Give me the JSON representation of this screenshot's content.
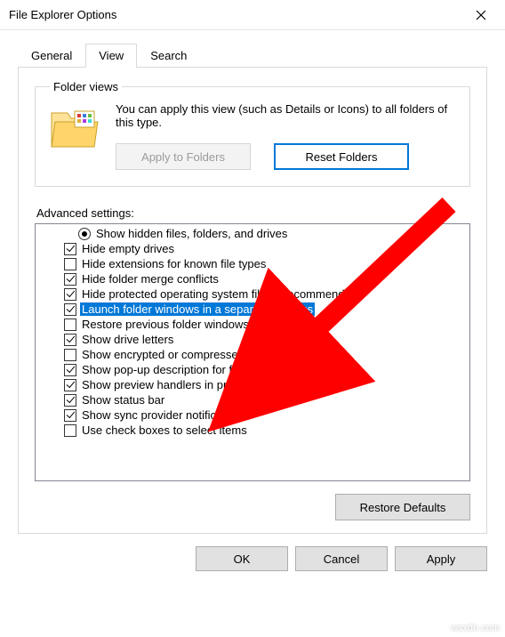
{
  "window": {
    "title": "File Explorer Options"
  },
  "tabs": {
    "general": "General",
    "view": "View",
    "search": "Search"
  },
  "folder_views": {
    "legend": "Folder views",
    "description": "You can apply this view (such as Details or Icons) to all folders of this type.",
    "apply_btn": "Apply to Folders",
    "reset_btn": "Reset Folders"
  },
  "advanced": {
    "label": "Advanced settings:",
    "items": [
      {
        "type": "radio",
        "checked": true,
        "label": "Show hidden files, folders, and drives"
      },
      {
        "type": "checkbox",
        "checked": true,
        "label": "Hide empty drives"
      },
      {
        "type": "checkbox",
        "checked": false,
        "label": "Hide extensions for known file types"
      },
      {
        "type": "checkbox",
        "checked": true,
        "label": "Hide folder merge conflicts"
      },
      {
        "type": "checkbox",
        "checked": true,
        "label": "Hide protected operating system files (Recommended)"
      },
      {
        "type": "checkbox",
        "checked": true,
        "label": "Launch folder windows in a separate process",
        "highlight": true
      },
      {
        "type": "checkbox",
        "checked": false,
        "label": "Restore previous folder windows at logon"
      },
      {
        "type": "checkbox",
        "checked": true,
        "label": "Show drive letters"
      },
      {
        "type": "checkbox",
        "checked": false,
        "label": "Show encrypted or compressed NTFS files in color"
      },
      {
        "type": "checkbox",
        "checked": true,
        "label": "Show pop-up description for folder and desktop items"
      },
      {
        "type": "checkbox",
        "checked": true,
        "label": "Show preview handlers in preview pane"
      },
      {
        "type": "checkbox",
        "checked": true,
        "label": "Show status bar"
      },
      {
        "type": "checkbox",
        "checked": true,
        "label": "Show sync provider notifications"
      },
      {
        "type": "checkbox",
        "checked": false,
        "label": "Use check boxes to select items"
      }
    ],
    "restore_btn": "Restore Defaults"
  },
  "buttons": {
    "ok": "OK",
    "cancel": "Cancel",
    "apply": "Apply"
  },
  "watermark": "wsxdn.com"
}
